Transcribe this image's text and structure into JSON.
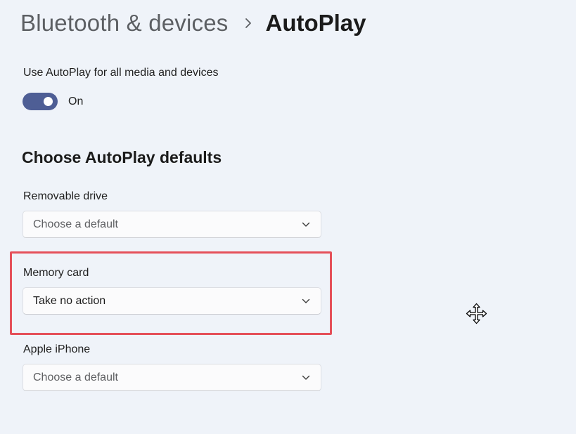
{
  "breadcrumb": {
    "parent": "Bluetooth & devices",
    "separator_icon": "chevron-right-icon",
    "current": "AutoPlay"
  },
  "autoplay_master": {
    "label": "Use AutoPlay for all media and devices",
    "toggle_on": true,
    "state_text": "On",
    "accent_color": "#4e5e95"
  },
  "defaults_section": {
    "title": "Choose AutoPlay defaults",
    "items": [
      {
        "label": "Removable drive",
        "value": "Choose a default",
        "is_placeholder": true
      },
      {
        "label": "Memory card",
        "value": "Take no action",
        "is_placeholder": false
      },
      {
        "label": "Apple iPhone",
        "value": "Choose a default",
        "is_placeholder": true
      }
    ]
  },
  "highlight": {
    "target": "Memory card",
    "color": "#e5505a"
  },
  "cursor": {
    "icon": "move-cursor-icon"
  }
}
